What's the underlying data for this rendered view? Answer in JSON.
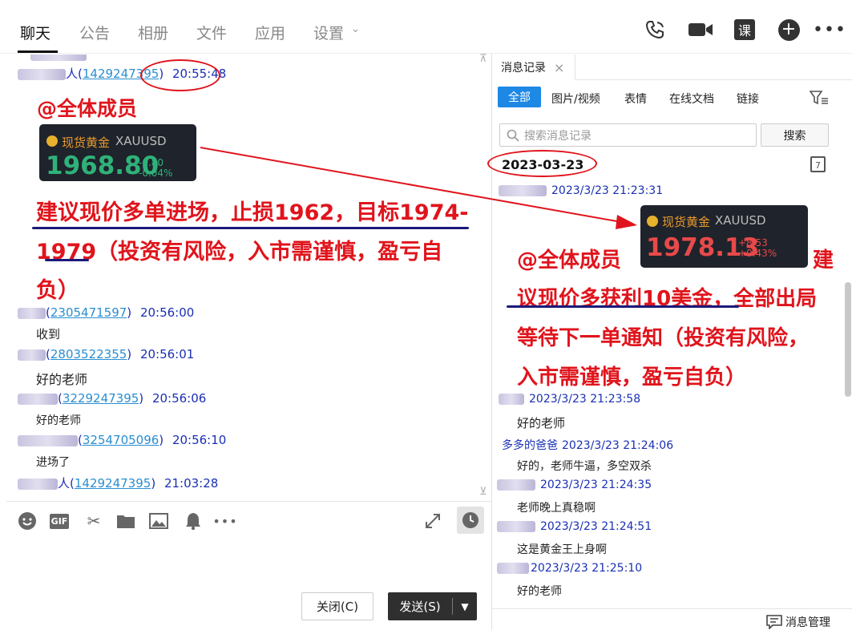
{
  "nav": {
    "tabs": [
      "聊天",
      "公告",
      "相册",
      "文件",
      "应用",
      "设置"
    ],
    "active": "聊天"
  },
  "left_messages": [
    {
      "name_suffix": "人",
      "uid": "1429247395",
      "time": "20:55:48"
    },
    {
      "name_suffix": "",
      "uid": "2305471597",
      "time": "20:56:00",
      "text": "收到"
    },
    {
      "name_suffix": "",
      "uid": "2803522355",
      "time": "20:56:01",
      "text": "好的老师"
    },
    {
      "name_suffix": "",
      "uid": "3229247395",
      "time": "20:56:06",
      "text": "好的老师"
    },
    {
      "name_suffix": "",
      "uid": "3254705096",
      "time": "20:56:10",
      "text": "进场了"
    },
    {
      "name_suffix": "人",
      "uid": "1429247395",
      "time": "21:03:28"
    }
  ],
  "left_post": {
    "mention": "@全体成员",
    "line1": "建议现价多单进场，止损1962，目标1974-",
    "line2": "1979（投资有风险，入市需谨慎，盈亏自",
    "line3": "负）"
  },
  "gold_left": {
    "name": "现货黄金",
    "symbol": "XAUUSD",
    "price": "1968.80",
    "chg": "-0.80",
    "pct": "-0.04%"
  },
  "gold_right": {
    "name": "现货黄金",
    "symbol": "XAUUSD",
    "price": "1978.13",
    "chg": "+8.53",
    "pct": "+0.43%"
  },
  "composer": {
    "close_label": "关闭(C)",
    "send_label": "发送(S)",
    "gif_label": "GIF"
  },
  "history": {
    "title": "消息记录",
    "filters": [
      "全部",
      "图片/视频",
      "表情",
      "在线文档",
      "链接"
    ],
    "active_filter": "全部",
    "search_placeholder": "搜索消息记录",
    "search_button": "搜索",
    "date": "2023-03-23",
    "calendar_day": "7",
    "first_time": "2023/3/23 21:23:31",
    "post": {
      "mention": "@全体成员",
      "line1_tail": "建",
      "line2": "议现价多获利10美金，全部出局",
      "line3": "等待下一单通知（投资有风险，",
      "line4": "入市需谨慎，盈亏自负）"
    },
    "messages": [
      {
        "sender": "",
        "time": "2023/3/23 21:23:58",
        "text": "好的老师"
      },
      {
        "sender": "多多的爸爸",
        "time": "2023/3/23 21:24:06",
        "text": "好的，老师牛逼，多空双杀"
      },
      {
        "sender": "",
        "time": "2023/3/23 21:24:35",
        "text": "老师晚上真稳啊"
      },
      {
        "sender": "",
        "time": "2023/3/23 21:24:51",
        "text": "这是黄金王上身啊"
      },
      {
        "sender": "",
        "time": "2023/3/23 21:25:10",
        "text": "好的老师"
      }
    ],
    "footer": "消息管理"
  },
  "colors": {
    "red": "#e0141c",
    "blue": "#1a2fb5",
    "link": "#2a8ed2",
    "accent": "#1e88e5"
  }
}
